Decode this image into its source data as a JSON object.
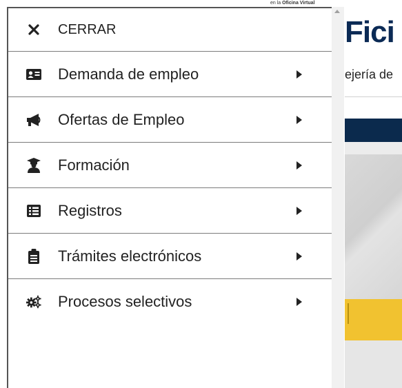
{
  "background": {
    "top_strip_prefix": "en la ",
    "top_strip_bold": "Oficina Virtual",
    "logo_text": "Fici",
    "subtitle_text": "ejería de"
  },
  "menu": {
    "close_label": "CERRAR",
    "items": [
      {
        "label": "Demanda de empleo",
        "icon": "id-card-icon"
      },
      {
        "label": "Ofertas de Empleo",
        "icon": "megaphone-icon"
      },
      {
        "label": "Formación",
        "icon": "graduate-icon"
      },
      {
        "label": "Registros",
        "icon": "list-icon"
      },
      {
        "label": "Trámites electrónicos",
        "icon": "clipboard-icon"
      },
      {
        "label": "Procesos selectivos",
        "icon": "cogs-icon"
      }
    ]
  },
  "colors": {
    "navy": "#0b2a4d",
    "text": "#222222",
    "border": "#7a7a7a"
  }
}
